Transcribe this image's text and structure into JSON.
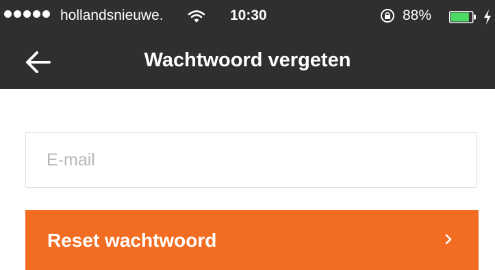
{
  "status_bar": {
    "carrier": "hollandsnieuwe.",
    "time": "10:30",
    "battery_percent": "88%",
    "battery_level": 0.88,
    "signal_dots": 5,
    "icons": [
      "wifi-icon",
      "rotation-lock-icon",
      "battery-icon",
      "charging-bolt-icon"
    ]
  },
  "nav": {
    "back_icon": "back-arrow-icon",
    "title": "Wachtwoord vergeten"
  },
  "form": {
    "email_placeholder": "E-mail",
    "email_value": "",
    "submit_label": "Reset wachtwoord",
    "submit_icon": "chevron-right-icon"
  },
  "colors": {
    "header_bg": "#2f2f2f",
    "accent": "#f26d21",
    "text_light": "#ffffff",
    "placeholder": "#b7b7b7",
    "field_border": "#dcdcdc"
  }
}
